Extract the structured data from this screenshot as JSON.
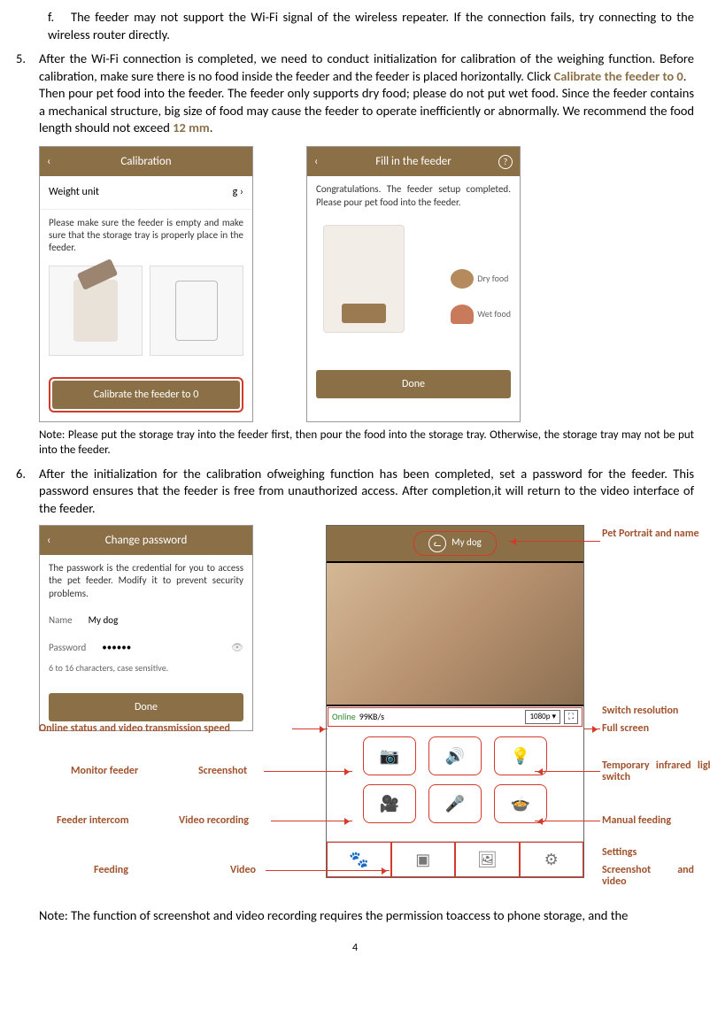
{
  "item_f": {
    "letter": "f.",
    "text": "The feeder may not support the Wi-Fi signal of the wireless repeater. If the connection fails, try connecting to the wireless router directly."
  },
  "step5": {
    "num": "5.",
    "p1a": "After the Wi-Fi connection is completed, we need to conduct initialization for calibration of the weighing function. Before calibration, make sure there is no food inside the feeder and the feeder is placed horizontally. Click ",
    "p1_emph": "Calibrate the feeder to 0",
    "p1b": ".",
    "p2a": "Then pour pet food into the feeder. The feeder only supports dry food; please do not put wet food. Since the feeder contains a mechanical structure, big size of food may cause the feeder to operate inefficiently or abnormally. We recommend the food length should not exceed ",
    "p2_emph": "12 mm",
    "p2b": ".",
    "note": "Note: Please put the storage tray into the feeder first, then pour the food into the storage tray. Otherwise, the storage tray may not be put into the feeder."
  },
  "calib_screen": {
    "title": "Calibration",
    "weight_unit_label": "Weight unit",
    "weight_unit_value": "g  ›",
    "instruction": "Please make sure the feeder is empty and make sure that the storage tray is properly place in the feeder.",
    "button": "Calibrate the feeder to 0"
  },
  "fill_screen": {
    "title": "Fill in the feeder",
    "congrats": "Congratulations. The feeder setup completed. Please pour pet food into the feeder.",
    "dry": "Dry food",
    "wet": "Wet food",
    "done": "Done"
  },
  "step6": {
    "num": "6.",
    "text": "After the initialization for the calibration ofweighing function has been completed, set a password for the feeder. This password ensures that the feeder is free from unauthorized access. After completion,it will return to the video interface of the feeder.",
    "note": "Note: The function of screenshot and video recording requires the permission toaccess to phone storage, and the"
  },
  "pwd_screen": {
    "title": "Change password",
    "desc": "The passwork is the credential for you to access the pet feeder. Modify it to prevent security problems.",
    "name_label": "Name",
    "name_value": "My dog",
    "pwd_label": "Password",
    "pwd_value": "••••••",
    "hint": "6 to 16 characters, case sensitive.",
    "done": "Done"
  },
  "video_screen": {
    "pet_name": "My dog",
    "online": "Online",
    "speed": "99KB/s",
    "resolution": "1080p ▾"
  },
  "labels": {
    "pet_portrait": "Pet Portrait and name",
    "switch_res": "Switch resolution",
    "full_screen": "Full screen",
    "online_status": "Online status and video transmission speed",
    "monitor": "Monitor feeder",
    "screenshot": "Screenshot",
    "temp_ir": "Temporary infrared light switch",
    "intercom": "Feeder intercom",
    "vrec": "Video recording",
    "manual": "Manual feeding",
    "settings": "Settings",
    "feeding": "Feeding",
    "video": "Video",
    "sv": "Screenshot and video"
  },
  "page": "4"
}
